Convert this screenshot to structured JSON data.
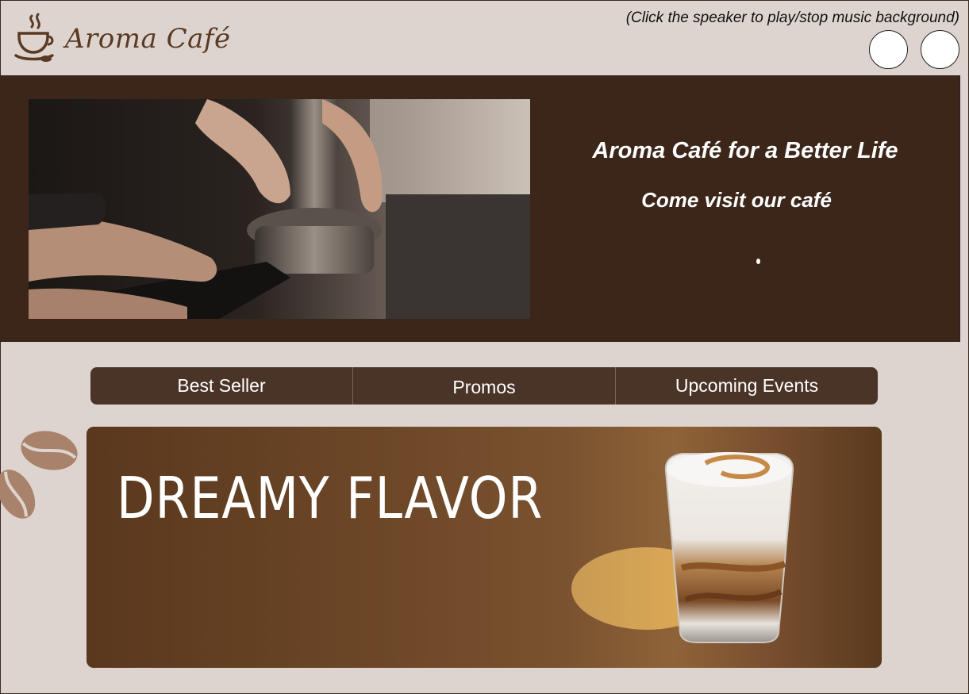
{
  "header": {
    "brand": "Aroma Café",
    "music_hint": "(Click the speaker to play/stop music background)"
  },
  "hero": {
    "title": "Aroma Café for a Better Life",
    "subtitle": "Come visit our café"
  },
  "tabs": [
    {
      "label": "Best Seller"
    },
    {
      "label": "Promos"
    },
    {
      "label": "Upcoming Events"
    }
  ],
  "banner": {
    "title": "DREAMY FLAVOR"
  },
  "icons": {
    "logo": "coffee-cup-icon",
    "beans": "coffee-beans-icon"
  },
  "colors": {
    "background": "#ddd4cf",
    "hero": "#3b2619",
    "tabs": "#4a3428",
    "brand": "#5a3a22"
  }
}
